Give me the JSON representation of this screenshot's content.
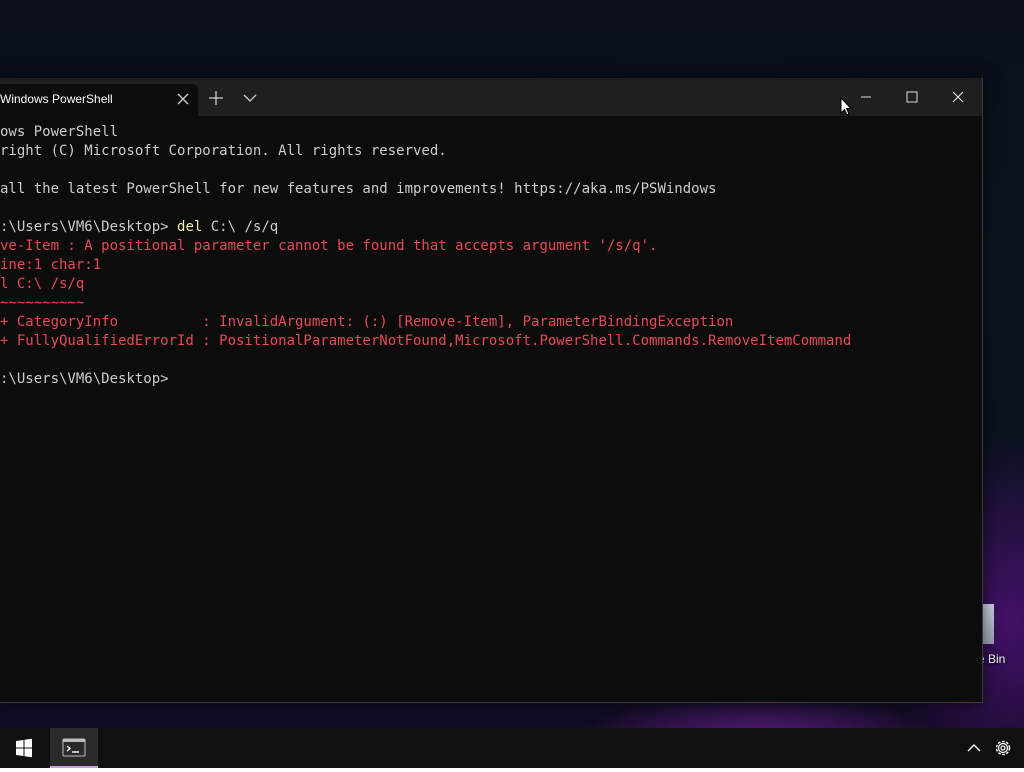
{
  "window": {
    "tab_title": "Windows PowerShell",
    "controls": {
      "minimize_icon": "minimize-icon",
      "maximize_icon": "maximize-icon",
      "close_icon": "close-icon"
    }
  },
  "terminal": {
    "lines": [
      {
        "text": "ows PowerShell",
        "type": "normal"
      },
      {
        "text": "right (C) Microsoft Corporation. All rights reserved.",
        "type": "normal"
      },
      {
        "text": "",
        "type": "normal"
      },
      {
        "text": "all the latest PowerShell for new features and improvements! https://aka.ms/PSWindows",
        "type": "normal"
      },
      {
        "text": "",
        "type": "normal"
      },
      {
        "text": ":\\Users\\VM6\\Desktop> ",
        "type": "prompt",
        "command": "del",
        "args": " C:\\ /s/q"
      },
      {
        "text": "ve-Item : A positional parameter cannot be found that accepts argument '/s/q'.",
        "type": "error"
      },
      {
        "text": "ine:1 char:1",
        "type": "error"
      },
      {
        "text": "l C:\\ /s/q",
        "type": "error"
      },
      {
        "text": "~~~~~~~~~~",
        "type": "error"
      },
      {
        "text": "+ CategoryInfo          : InvalidArgument: (:) [Remove-Item], ParameterBindingException",
        "type": "error"
      },
      {
        "text": "+ FullyQualifiedErrorId : PositionalParameterNotFound,Microsoft.PowerShell.Commands.RemoveItemCommand",
        "type": "error"
      },
      {
        "text": "",
        "type": "normal"
      },
      {
        "text": ":\\Users\\VM6\\Desktop>",
        "type": "normal"
      }
    ]
  },
  "desktop": {
    "recycle_bin_label": "e Bin"
  },
  "taskbar": {
    "start_icon": "windows-logo-icon",
    "app_icon": "terminal-icon",
    "tray_icon": "chevron-up-icon",
    "settings_icon": "gear-icon"
  },
  "colors": {
    "terminal_bg": "#0c0c0c",
    "text": "#cccccc",
    "error": "#e74856",
    "command": "#f9f1a5"
  }
}
